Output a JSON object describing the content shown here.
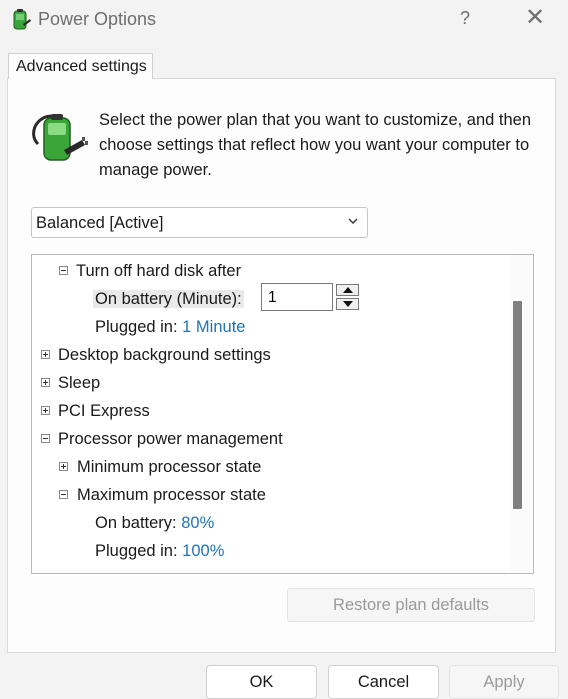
{
  "window": {
    "title": "Power Options",
    "help_label": "?",
    "close_label": "✕"
  },
  "tab": {
    "label": "Advanced settings"
  },
  "description": "Select the power plan that you want to customize, and then choose settings that reflect how you want your computer to manage power.",
  "plan_select": {
    "value": "Balanced [Active]"
  },
  "tree": {
    "hard_disk": {
      "label": "Turn off hard disk after",
      "on_battery_label": "On battery (Minute):",
      "on_battery_value": "1",
      "plugged_in_label": "Plugged in:",
      "plugged_in_value": "1 Minute"
    },
    "desktop_background": {
      "label": "Desktop background settings"
    },
    "sleep": {
      "label": "Sleep"
    },
    "pci_express": {
      "label": "PCI Express"
    },
    "processor": {
      "label": "Processor power management",
      "minimum": {
        "label": "Minimum processor state"
      },
      "maximum": {
        "label": "Maximum processor state",
        "on_battery_label": "On battery:",
        "on_battery_value": "80%",
        "plugged_in_label": "Plugged in:",
        "plugged_in_value": "100%"
      }
    }
  },
  "buttons": {
    "restore": "Restore plan defaults",
    "ok": "OK",
    "cancel": "Cancel",
    "apply": "Apply"
  },
  "colors": {
    "accent_value": "#1f73b7",
    "disabled_text": "#9a9a9a",
    "battery_green": "#3aa63a"
  },
  "icons": {
    "app": "battery-plug-icon",
    "plan": "battery-plug-large-icon",
    "dropdown": "chevron-down-icon"
  }
}
